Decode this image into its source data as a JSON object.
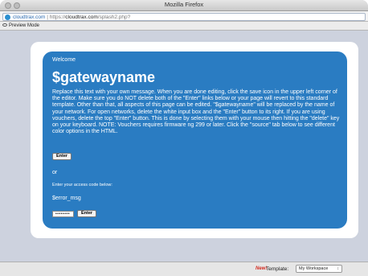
{
  "window": {
    "title": "Mozilla Firefox"
  },
  "address_bar": {
    "domain": "cloudtrax.com",
    "url_prefix": "https://",
    "url_host": "cloudtrax.com",
    "url_path": "/splash2.php?"
  },
  "toolbar": {
    "preview_mode_label": "Preview Mode"
  },
  "splash": {
    "welcome": "Welcome",
    "title": "$gatewayname",
    "body": "Replace this text with your own message.  When you are done editing, click the save icon in the upper left corner of the editor.  Make sure you do NOT delete both of the \"Enter\" links below or your page will revert to this standard template.  Other than that, all aspects of this page can be edited.  \"$gatewayname\" will be replaced by the name of your network. For open networks, delete the white input box and the \"Enter\" button to its right. If you are using vouchers, delete the top \"Enter\" button. This is done by selecting them with your mouse then hitting the \"delete\" key on your keyboard. NOTE: Vouchers requires firmware ng 299 or later. Click the \"source\" tab below to see different color options in the HTML.",
    "enter_button_top": "Enter",
    "or_text": "or",
    "access_code_label": "Enter your access code below:",
    "error_msg": "$error_msg",
    "access_code_value": "••••••••",
    "enter_button_bottom": "Enter"
  },
  "statusbar": {
    "new_badge": "New!",
    "template_label": "Template:",
    "template_selected": "My Workspace"
  },
  "colors": {
    "splash_blue": "#2a7cc2",
    "page_background": "#cdd2de",
    "new_red": "#d32a1f"
  }
}
